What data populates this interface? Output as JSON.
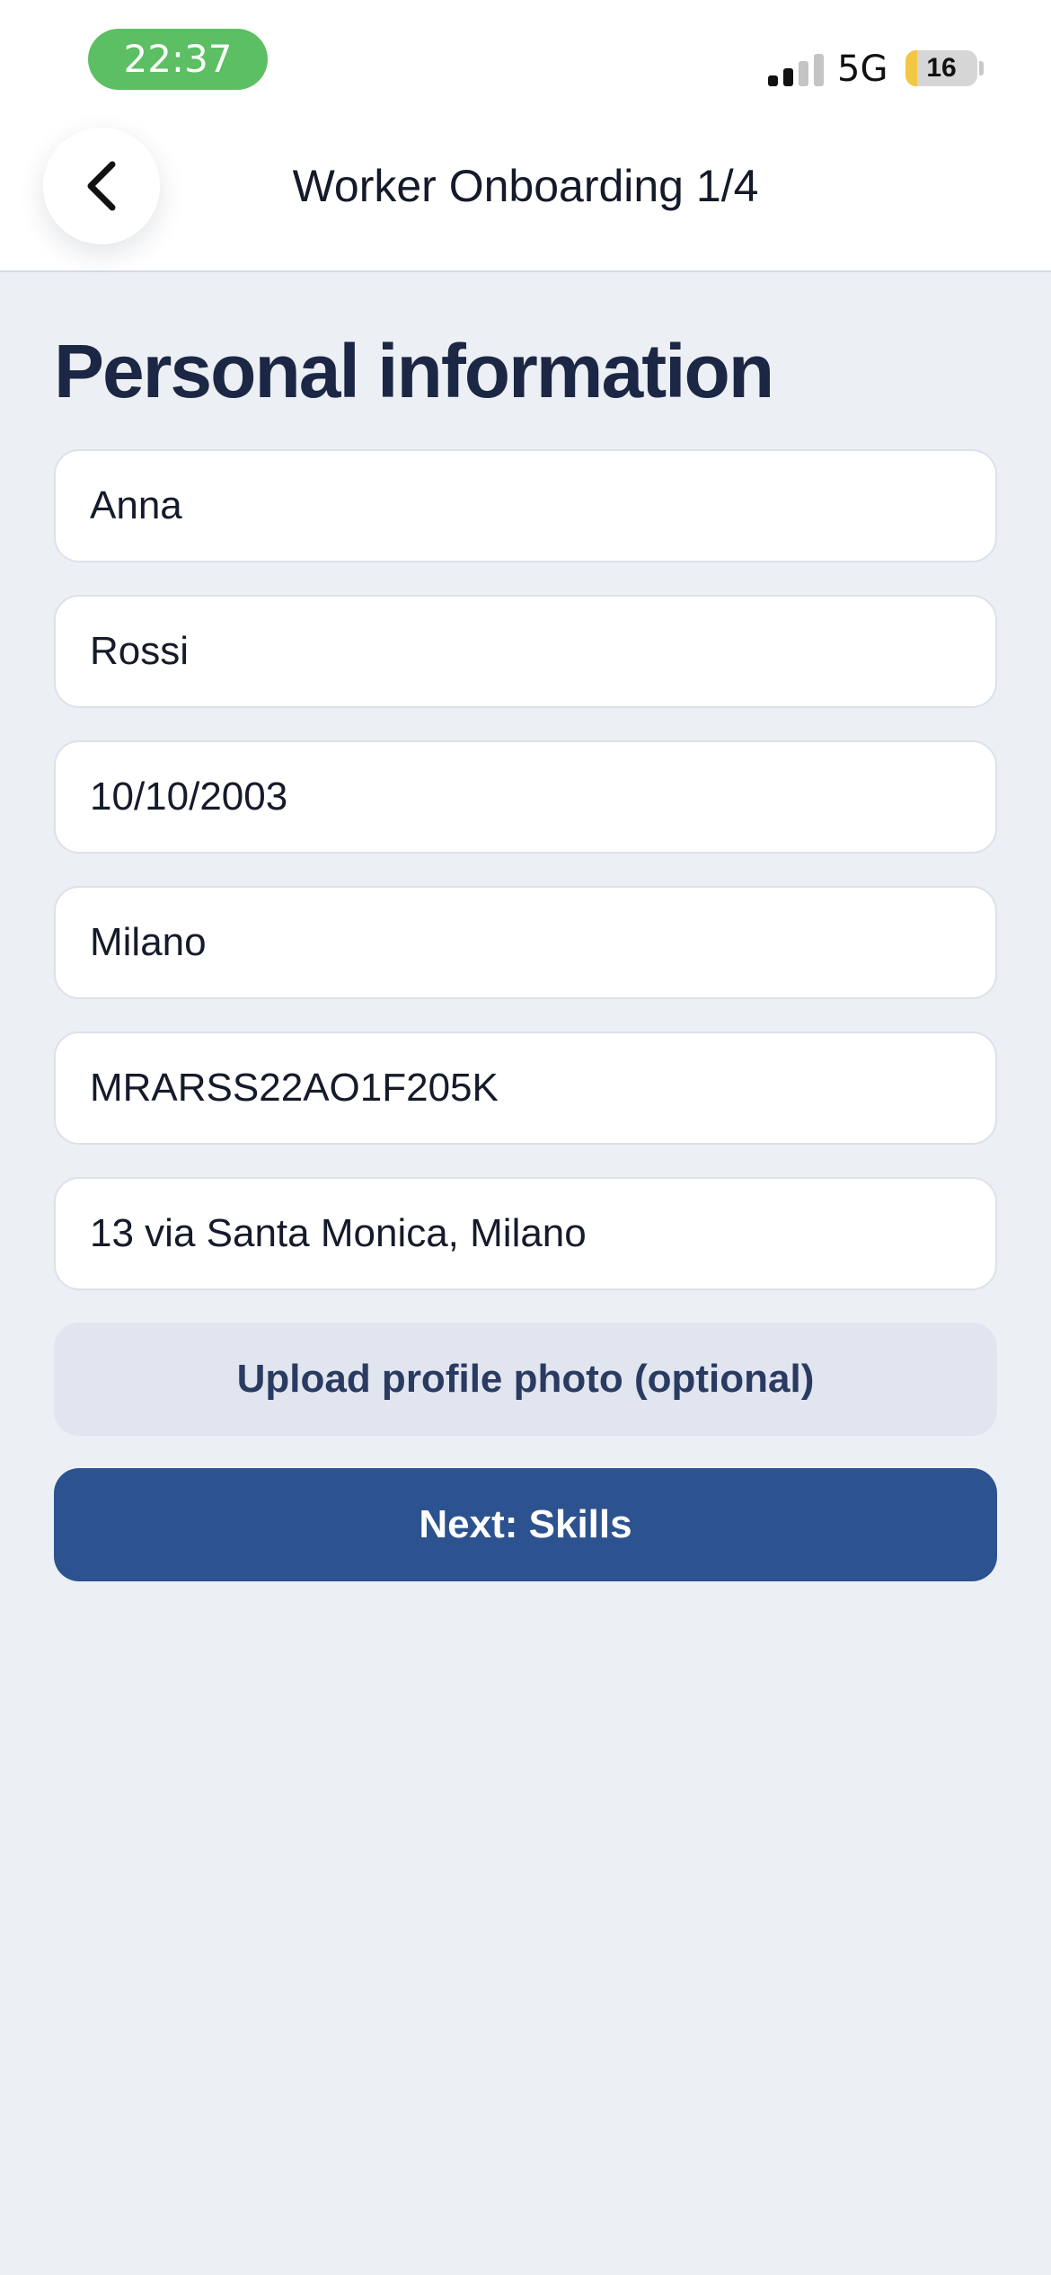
{
  "status_bar": {
    "time": "22:37",
    "network": "5G",
    "battery_level": "16",
    "battery_fraction": 0.16,
    "signal_bars_active": 2,
    "signal_bars_total": 4,
    "time_pill_color": "#5CBF63",
    "battery_color": "#F3C644"
  },
  "nav": {
    "title": "Worker Onboarding 1/4",
    "back_icon": "chevron-left-icon"
  },
  "page": {
    "heading": "Personal information"
  },
  "form": {
    "first_name": "Anna",
    "last_name": "Rossi",
    "birth_date": "10/10/2003",
    "birth_place": "Milano",
    "tax_code": "MRARSS22AO1F205K",
    "address": "13 via Santa Monica, Milano"
  },
  "actions": {
    "upload_label": "Upload profile photo (optional)",
    "next_label": "Next: Skills",
    "primary_color": "#2C528F"
  }
}
